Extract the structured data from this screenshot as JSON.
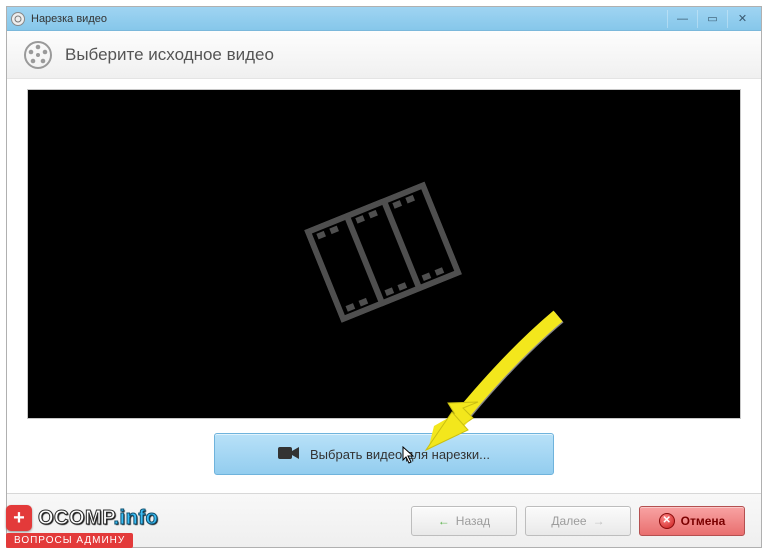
{
  "titlebar": {
    "title": "Нарезка видео"
  },
  "header": {
    "title": "Выберите исходное видео"
  },
  "main": {
    "select_label": "Выбрать видео для нарезки..."
  },
  "footer": {
    "back_label": "Назад",
    "next_label": "Далее",
    "cancel_label": "Отмена"
  },
  "watermark": {
    "brand": "OCOMP",
    "suffix": ".info",
    "subtitle": "ВОПРОСЫ АДМИНУ"
  }
}
